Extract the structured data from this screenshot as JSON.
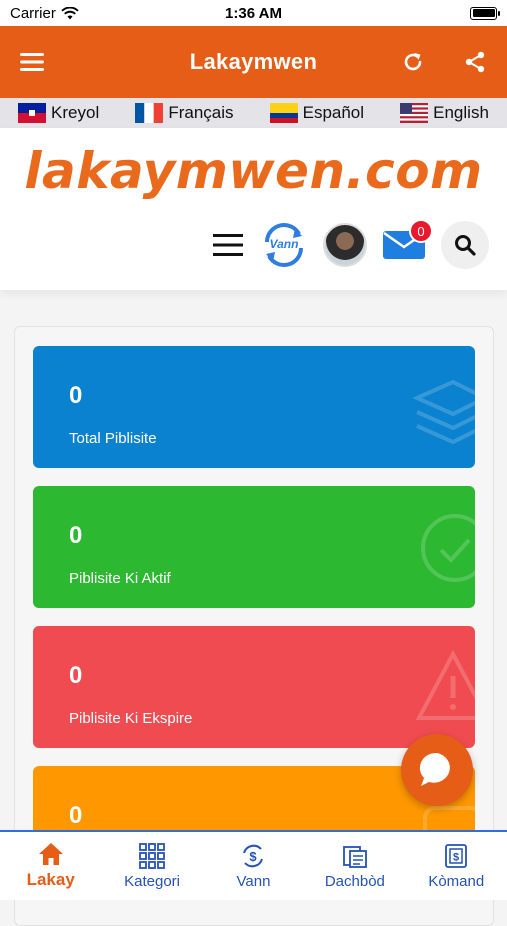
{
  "status_bar": {
    "carrier": "Carrier",
    "time": "1:36 AM"
  },
  "app_bar": {
    "title": "Lakaymwen"
  },
  "languages": [
    {
      "label": "Kreyol",
      "flag": "haiti"
    },
    {
      "label": "Français",
      "flag": "france"
    },
    {
      "label": "Español",
      "flag": "colombia"
    },
    {
      "label": "English",
      "flag": "usa"
    }
  ],
  "header": {
    "logo": "lakaymwen.com",
    "vann_label": "Vann",
    "mail_count": "0"
  },
  "stats": [
    {
      "value": "0",
      "label": "Total Piblisite",
      "color": "#0a82cf",
      "icon": "layers-icon"
    },
    {
      "value": "0",
      "label": "Piblisite Ki Aktif",
      "color": "#2db832",
      "icon": "check-circle-icon"
    },
    {
      "value": "0",
      "label": "Piblisite Ki Ekspire",
      "color": "#f04b50",
      "icon": "warning-icon"
    },
    {
      "value": "0",
      "label": "",
      "color": "#ff9800",
      "icon": "stat-icon"
    }
  ],
  "bottom_nav": [
    {
      "label": "Lakay",
      "icon": "home-icon"
    },
    {
      "label": "Kategori",
      "icon": "grid-icon"
    },
    {
      "label": "Vann",
      "icon": "dollar-icon"
    },
    {
      "label": "Dachbòd",
      "icon": "dashboard-icon"
    },
    {
      "label": "Kòmand",
      "icon": "orders-icon"
    }
  ]
}
